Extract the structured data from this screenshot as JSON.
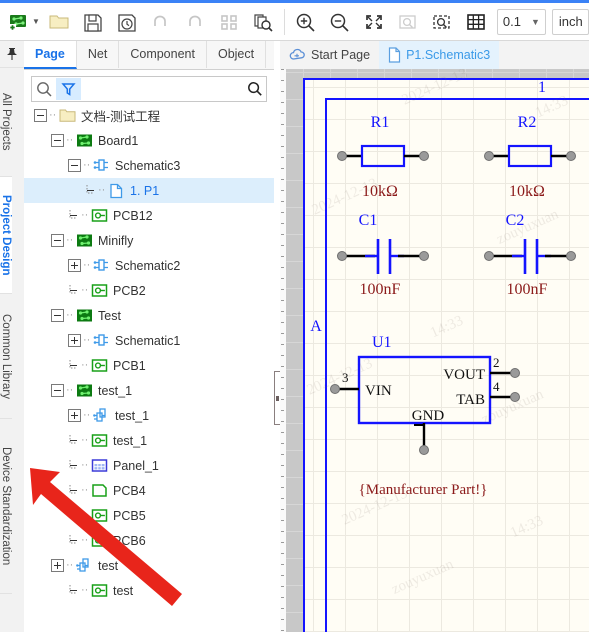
{
  "toolbar": {
    "buttons": [
      {
        "name": "new-project-icon",
        "title": "New"
      },
      {
        "name": "dropdown-caret-icon",
        "title": "More"
      },
      {
        "name": "open-folder-icon",
        "title": "Open"
      },
      {
        "name": "save-icon",
        "title": "Save"
      },
      {
        "name": "save-as-icon",
        "title": "Save As"
      },
      {
        "name": "undo-icon",
        "title": "Undo"
      },
      {
        "name": "redo-icon",
        "title": "Redo"
      },
      {
        "name": "grid-select-icon",
        "title": "Select"
      },
      {
        "name": "document-search-icon",
        "title": "Find in documents"
      },
      {
        "name": "zoom-in-icon",
        "title": "Zoom In"
      },
      {
        "name": "zoom-out-icon",
        "title": "Zoom Out"
      },
      {
        "name": "fit-screen-icon",
        "title": "Fit to Screen"
      },
      {
        "name": "zoom-area-disabled-icon",
        "title": "Zoom Area"
      },
      {
        "name": "zoom-selection-icon",
        "title": "Zoom Selection"
      },
      {
        "name": "grid-toggle-icon",
        "title": "Grid"
      }
    ],
    "zoom_value": "0.1",
    "unit_value": "inch"
  },
  "rail": {
    "pin": "pin-icon",
    "tabs": [
      {
        "label": "All Projects",
        "active": false
      },
      {
        "label": "Project Design",
        "active": true
      },
      {
        "label": "Common Library",
        "active": false
      },
      {
        "label": "Device Standardization",
        "active": false
      }
    ]
  },
  "panel": {
    "tabs": [
      {
        "label": "Page",
        "active": true
      },
      {
        "label": "Net",
        "active": false
      },
      {
        "label": "Component",
        "active": false
      },
      {
        "label": "Object",
        "active": false
      }
    ],
    "search": {
      "value": "",
      "placeholder": "",
      "magnifier_icon": "search-icon",
      "filter_icon": "filter-icon",
      "go_icon": "search-icon"
    },
    "tree": [
      {
        "label": "文档-测试工程",
        "indent": 0,
        "icon": "folder-icon",
        "expander": "minus",
        "selected": false
      },
      {
        "label": "Board1",
        "indent": 1,
        "icon": "board-icon",
        "expander": "minus",
        "selected": false
      },
      {
        "label": "Schematic3",
        "indent": 2,
        "icon": "schematic-icon",
        "expander": "minus",
        "selected": false
      },
      {
        "label": "1. P1",
        "indent": 3,
        "icon": "page-icon",
        "expander": "none",
        "selected": true
      },
      {
        "label": "PCB12",
        "indent": 2,
        "icon": "pcb-icon",
        "expander": "none",
        "selected": false
      },
      {
        "label": "Minifly",
        "indent": 1,
        "icon": "board-icon",
        "expander": "minus",
        "selected": false
      },
      {
        "label": "Schematic2",
        "indent": 2,
        "icon": "schematic-icon",
        "expander": "plus",
        "selected": false
      },
      {
        "label": "PCB2",
        "indent": 2,
        "icon": "pcb-icon",
        "expander": "none",
        "selected": false
      },
      {
        "label": "Test",
        "indent": 1,
        "icon": "board-icon",
        "expander": "minus",
        "selected": false
      },
      {
        "label": "Schematic1",
        "indent": 2,
        "icon": "schematic-icon",
        "expander": "plus",
        "selected": false
      },
      {
        "label": "PCB1",
        "indent": 2,
        "icon": "pcb-icon",
        "expander": "none",
        "selected": false
      },
      {
        "label": "test_1",
        "indent": 1,
        "icon": "board-icon",
        "expander": "minus",
        "selected": false
      },
      {
        "label": "test_1",
        "indent": 2,
        "icon": "schematic-multi-icon",
        "expander": "plus",
        "selected": false
      },
      {
        "label": "test_1",
        "indent": 2,
        "icon": "pcb-icon",
        "expander": "none",
        "selected": false
      },
      {
        "label": "Panel_1",
        "indent": 2,
        "icon": "panel-icon",
        "expander": "none",
        "selected": false
      },
      {
        "label": "PCB4",
        "indent": 2,
        "icon": "pcb-empty-icon",
        "expander": "none",
        "selected": false
      },
      {
        "label": "PCB5",
        "indent": 2,
        "icon": "pcb-icon",
        "expander": "none",
        "selected": false
      },
      {
        "label": "PCB6",
        "indent": 2,
        "icon": "pcb-icon",
        "expander": "none",
        "selected": false
      },
      {
        "label": "test",
        "indent": 1,
        "icon": "schematic-multi-icon",
        "expander": "plus",
        "selected": false
      },
      {
        "label": "test",
        "indent": 2,
        "icon": "pcb-icon",
        "expander": "none",
        "selected": false
      }
    ]
  },
  "editor": {
    "tabs": [
      {
        "label": "Start Page",
        "icon": "cloud-icon",
        "active": false
      },
      {
        "label": "P1.Schematic3",
        "icon": "page-icon",
        "active": true
      }
    ]
  },
  "schematic": {
    "frame": {
      "zone_top": "1",
      "zone_left": "A"
    },
    "components": [
      {
        "ref": "R1",
        "value": "10kΩ",
        "type": "resistor"
      },
      {
        "ref": "R2",
        "value": "10kΩ",
        "type": "resistor"
      },
      {
        "ref": "C1",
        "value": "100nF",
        "type": "capacitor"
      },
      {
        "ref": "C2",
        "value": "100nF",
        "type": "capacitor"
      },
      {
        "ref": "U1",
        "value": "{Manufacturer Part!}",
        "type": "ic",
        "pins": [
          {
            "name": "VIN",
            "number": "3"
          },
          {
            "name": "VOUT",
            "number": "2"
          },
          {
            "name": "TAB",
            "number": "4"
          },
          {
            "name": "GND",
            "number": ""
          }
        ]
      }
    ],
    "watermarks": [
      "2024-12-13",
      "14:33",
      "zouyuxuan"
    ]
  },
  "annotation": {
    "arrow": "red-arrow-pointer"
  },
  "colors": {
    "accent": "#3b82f6",
    "tab_active": "#1a73e8",
    "schematic_blue": "#1414ff",
    "schematic_red": "#8b1a1a",
    "sheet_bg": "#fffdf5",
    "canvas_bg": "#c8c8c8"
  }
}
